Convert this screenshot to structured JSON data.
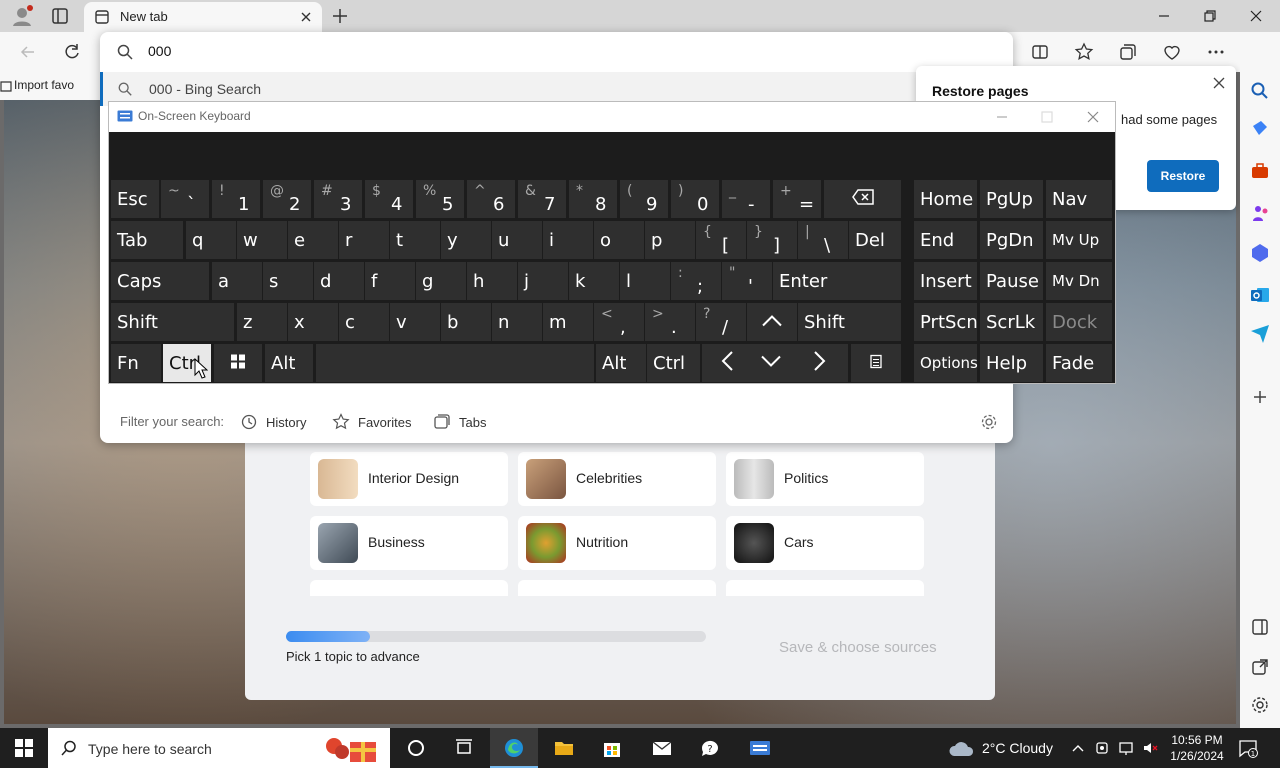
{
  "browser": {
    "tab_title": "New tab",
    "favorites_bar": {
      "import_label": "Import favo"
    }
  },
  "address": {
    "query": "000",
    "suggestion": "000 - Bing Search",
    "filter_label": "Filter your search:",
    "filters": [
      {
        "label": "History",
        "icon": "history-icon"
      },
      {
        "label": "Favorites",
        "icon": "star-icon"
      },
      {
        "label": "Tabs",
        "icon": "tabs-icon"
      }
    ]
  },
  "restore": {
    "title": "Restore pages",
    "text": "had some pages",
    "button": "Restore"
  },
  "osk": {
    "title": "On-Screen Keyboard",
    "row1": [
      {
        "label": "Esc"
      },
      {
        "sup": "~",
        "main": "`"
      },
      {
        "sup": "!",
        "main": "1"
      },
      {
        "sup": "@",
        "main": "2"
      },
      {
        "sup": "#",
        "main": "3"
      },
      {
        "sup": "$",
        "main": "4"
      },
      {
        "sup": "%",
        "main": "5"
      },
      {
        "sup": "^",
        "main": "6"
      },
      {
        "sup": "&",
        "main": "7"
      },
      {
        "sup": "*",
        "main": "8"
      },
      {
        "sup": "(",
        "main": "9"
      },
      {
        "sup": ")",
        "main": "0"
      },
      {
        "sup": "_",
        "main": "-"
      },
      {
        "sup": "+",
        "main": "="
      },
      {
        "icon": "backspace-icon"
      }
    ],
    "row2": [
      {
        "label": "Tab"
      },
      {
        "label": "q"
      },
      {
        "label": "w"
      },
      {
        "label": "e"
      },
      {
        "label": "r"
      },
      {
        "label": "t"
      },
      {
        "label": "y"
      },
      {
        "label": "u"
      },
      {
        "label": "i"
      },
      {
        "label": "o"
      },
      {
        "label": "p"
      },
      {
        "sup": "{",
        "main": "["
      },
      {
        "sup": "}",
        "main": "]"
      },
      {
        "sup": "|",
        "main": "\\"
      },
      {
        "label": "Del"
      }
    ],
    "row3": [
      {
        "label": "Caps"
      },
      {
        "label": "a"
      },
      {
        "label": "s"
      },
      {
        "label": "d"
      },
      {
        "label": "f"
      },
      {
        "label": "g"
      },
      {
        "label": "h"
      },
      {
        "label": "j"
      },
      {
        "label": "k"
      },
      {
        "label": "l"
      },
      {
        "sup": ":",
        "main": ";"
      },
      {
        "sup": "\"",
        "main": "'"
      },
      {
        "label": "Enter"
      }
    ],
    "row4": [
      {
        "label": "Shift"
      },
      {
        "label": "z"
      },
      {
        "label": "x"
      },
      {
        "label": "c"
      },
      {
        "label": "v"
      },
      {
        "label": "b"
      },
      {
        "label": "n"
      },
      {
        "label": "m"
      },
      {
        "sup": "<",
        "main": ","
      },
      {
        "sup": ">",
        "main": "."
      },
      {
        "sup": "?",
        "main": "/"
      },
      {
        "icon": "arrow-up-icon"
      },
      {
        "label": "Shift"
      }
    ],
    "row5": [
      {
        "label": "Fn"
      },
      {
        "label": "Ctrl"
      },
      {
        "icon": "windows-icon"
      },
      {
        "label": "Alt"
      },
      {
        "label": ""
      },
      {
        "label": "Alt"
      },
      {
        "label": "Ctrl"
      },
      {
        "icon": "arrow-left-icon"
      },
      {
        "icon": "arrow-down-icon"
      },
      {
        "icon": "arrow-right-icon"
      },
      {
        "icon": "menu-icon"
      }
    ],
    "nav": [
      [
        "Home",
        "PgUp",
        "Nav"
      ],
      [
        "End",
        "PgDn",
        "Mv Up"
      ],
      [
        "Insert",
        "Pause",
        "Mv Dn"
      ],
      [
        "PrtScn",
        "ScrLk",
        "Dock"
      ],
      [
        "Options",
        "Help",
        "Fade"
      ]
    ]
  },
  "topics": [
    {
      "label": "Interior Design"
    },
    {
      "label": "Celebrities"
    },
    {
      "label": "Politics"
    },
    {
      "label": "Business"
    },
    {
      "label": "Nutrition"
    },
    {
      "label": "Cars"
    }
  ],
  "onboarding": {
    "progress": 0.2,
    "pick_text": "Pick 1 topic to advance",
    "save_label": "Save & choose sources"
  },
  "taskbar": {
    "search_placeholder": "Type here to search",
    "weather": "2°C  Cloudy",
    "time": "10:56 PM",
    "date": "1/26/2024"
  },
  "colors": {
    "accent": "#0f6cbd",
    "key_bg": "#2f2f2f",
    "osk_bg": "#1c1c1c",
    "taskbar": "#1f1f1f"
  }
}
